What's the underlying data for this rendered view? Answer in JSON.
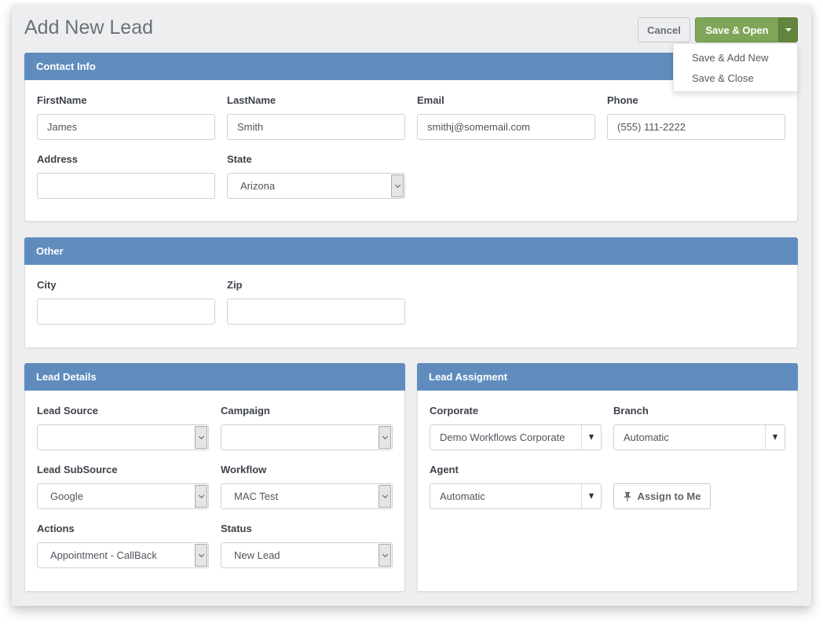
{
  "page": {
    "title": "Add New Lead"
  },
  "toolbar": {
    "cancel_label": "Cancel",
    "save_open_label": "Save & Open",
    "dropdown_icon": "caret-down-icon",
    "dropdown_items": [
      {
        "label": "Save & Add New"
      },
      {
        "label": "Save & Close"
      }
    ]
  },
  "colors": {
    "panel_header": "#608cbd",
    "primary_button": "#7fa658",
    "primary_button_dark": "#64853f",
    "background": "#edeef0"
  },
  "contact_info": {
    "title": "Contact Info",
    "first_name": {
      "label": "FirstName",
      "value": "James"
    },
    "last_name": {
      "label": "LastName",
      "value": "Smith"
    },
    "email": {
      "label": "Email",
      "value": "smithj@somemail.com"
    },
    "phone": {
      "label": "Phone",
      "value": "(555) 111-2222"
    },
    "address": {
      "label": "Address",
      "value": ""
    },
    "state": {
      "label": "State",
      "value": "Arizona"
    }
  },
  "other": {
    "title": "Other",
    "city": {
      "label": "City",
      "value": ""
    },
    "zip": {
      "label": "Zip",
      "value": ""
    }
  },
  "lead_details": {
    "title": "Lead Details",
    "lead_source": {
      "label": "Lead Source",
      "value": ""
    },
    "campaign": {
      "label": "Campaign",
      "value": ""
    },
    "lead_subsource": {
      "label": "Lead SubSource",
      "value": "Google"
    },
    "workflow": {
      "label": "Workflow",
      "value": "MAC Test"
    },
    "actions": {
      "label": "Actions",
      "value": "Appointment - CallBack"
    },
    "status": {
      "label": "Status",
      "value": "New Lead"
    }
  },
  "lead_assignment": {
    "title": "Lead Assigment",
    "corporate": {
      "label": "Corporate",
      "value": "Demo Workflows Corporate"
    },
    "branch": {
      "label": "Branch",
      "value": "Automatic"
    },
    "agent": {
      "label": "Agent",
      "value": "Automatic"
    },
    "assign_to_me_label": "Assign to Me",
    "assign_icon": "pushpin-icon"
  }
}
